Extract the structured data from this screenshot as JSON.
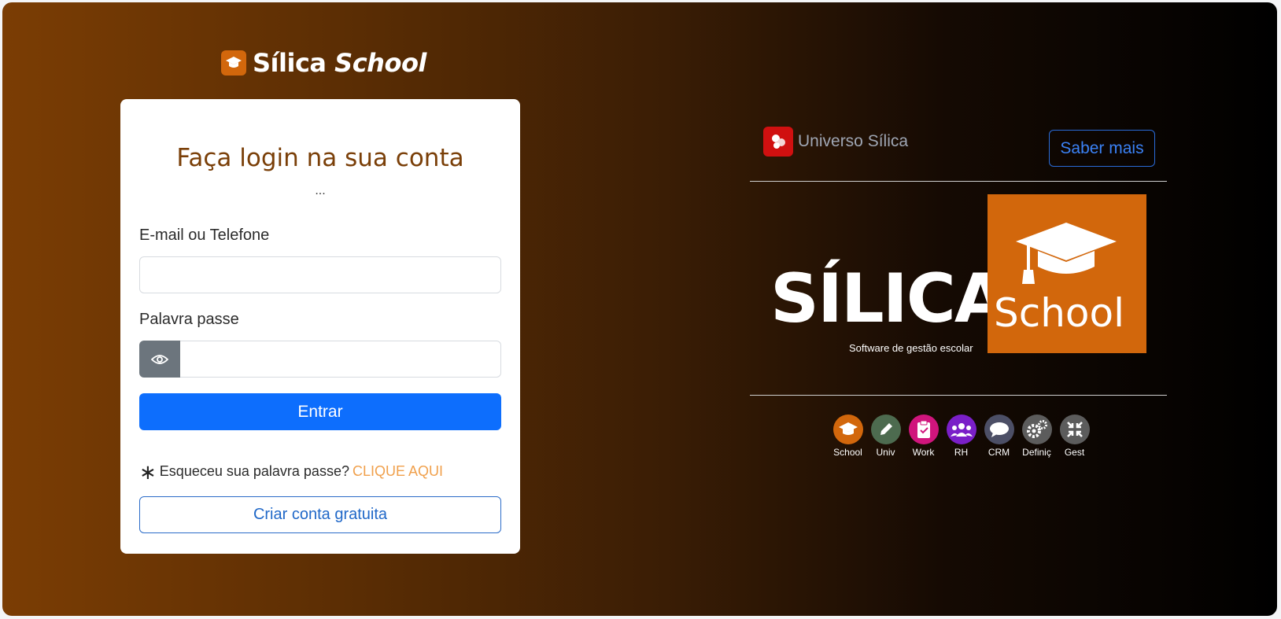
{
  "brand": {
    "name_regular": "Sílica",
    "name_italic": "School",
    "icon": "graduation-cap-icon"
  },
  "login": {
    "title": "Faça login na sua conta",
    "dots": "...",
    "email_label": "E-mail ou Telefone",
    "email_value": "",
    "email_placeholder": "",
    "password_label": "Palavra passe",
    "password_value": "",
    "password_placeholder": "",
    "toggle_icon": "eye-icon",
    "submit_label": "Entrar",
    "forgot_text": "Esqueceu sua palavra passe?",
    "forgot_link": "CLIQUE AQUI",
    "create_account_label": "Criar conta gratuita"
  },
  "universe": {
    "name": "Universo Sílica",
    "learn_more_label": "Saber mais",
    "hero": {
      "word": "SÍLICA",
      "box_text": "School",
      "subtitle": "Software de gestão escolar"
    },
    "apps": [
      {
        "label": "School",
        "icon": "graduation-cap-icon",
        "color": "#d2670c"
      },
      {
        "label": "Univ",
        "icon": "pencil-icon",
        "color": "#4d6b4f"
      },
      {
        "label": "Work",
        "icon": "clipboard-check-icon",
        "color": "#d0157c"
      },
      {
        "label": "RH",
        "icon": "users-icon",
        "color": "#7a1fc8"
      },
      {
        "label": "CRM",
        "icon": "chat-bubble-icon",
        "color": "#4c4f66"
      },
      {
        "label": "Definiç",
        "icon": "gears-icon",
        "color": "#5c5c5c"
      },
      {
        "label": "Gest",
        "icon": "compress-icon",
        "color": "#5c5c5c"
      }
    ]
  },
  "colors": {
    "accent": "#d2670c",
    "primary": "#0d6efd",
    "title": "#7a3f08",
    "link": "#f0a04c"
  }
}
